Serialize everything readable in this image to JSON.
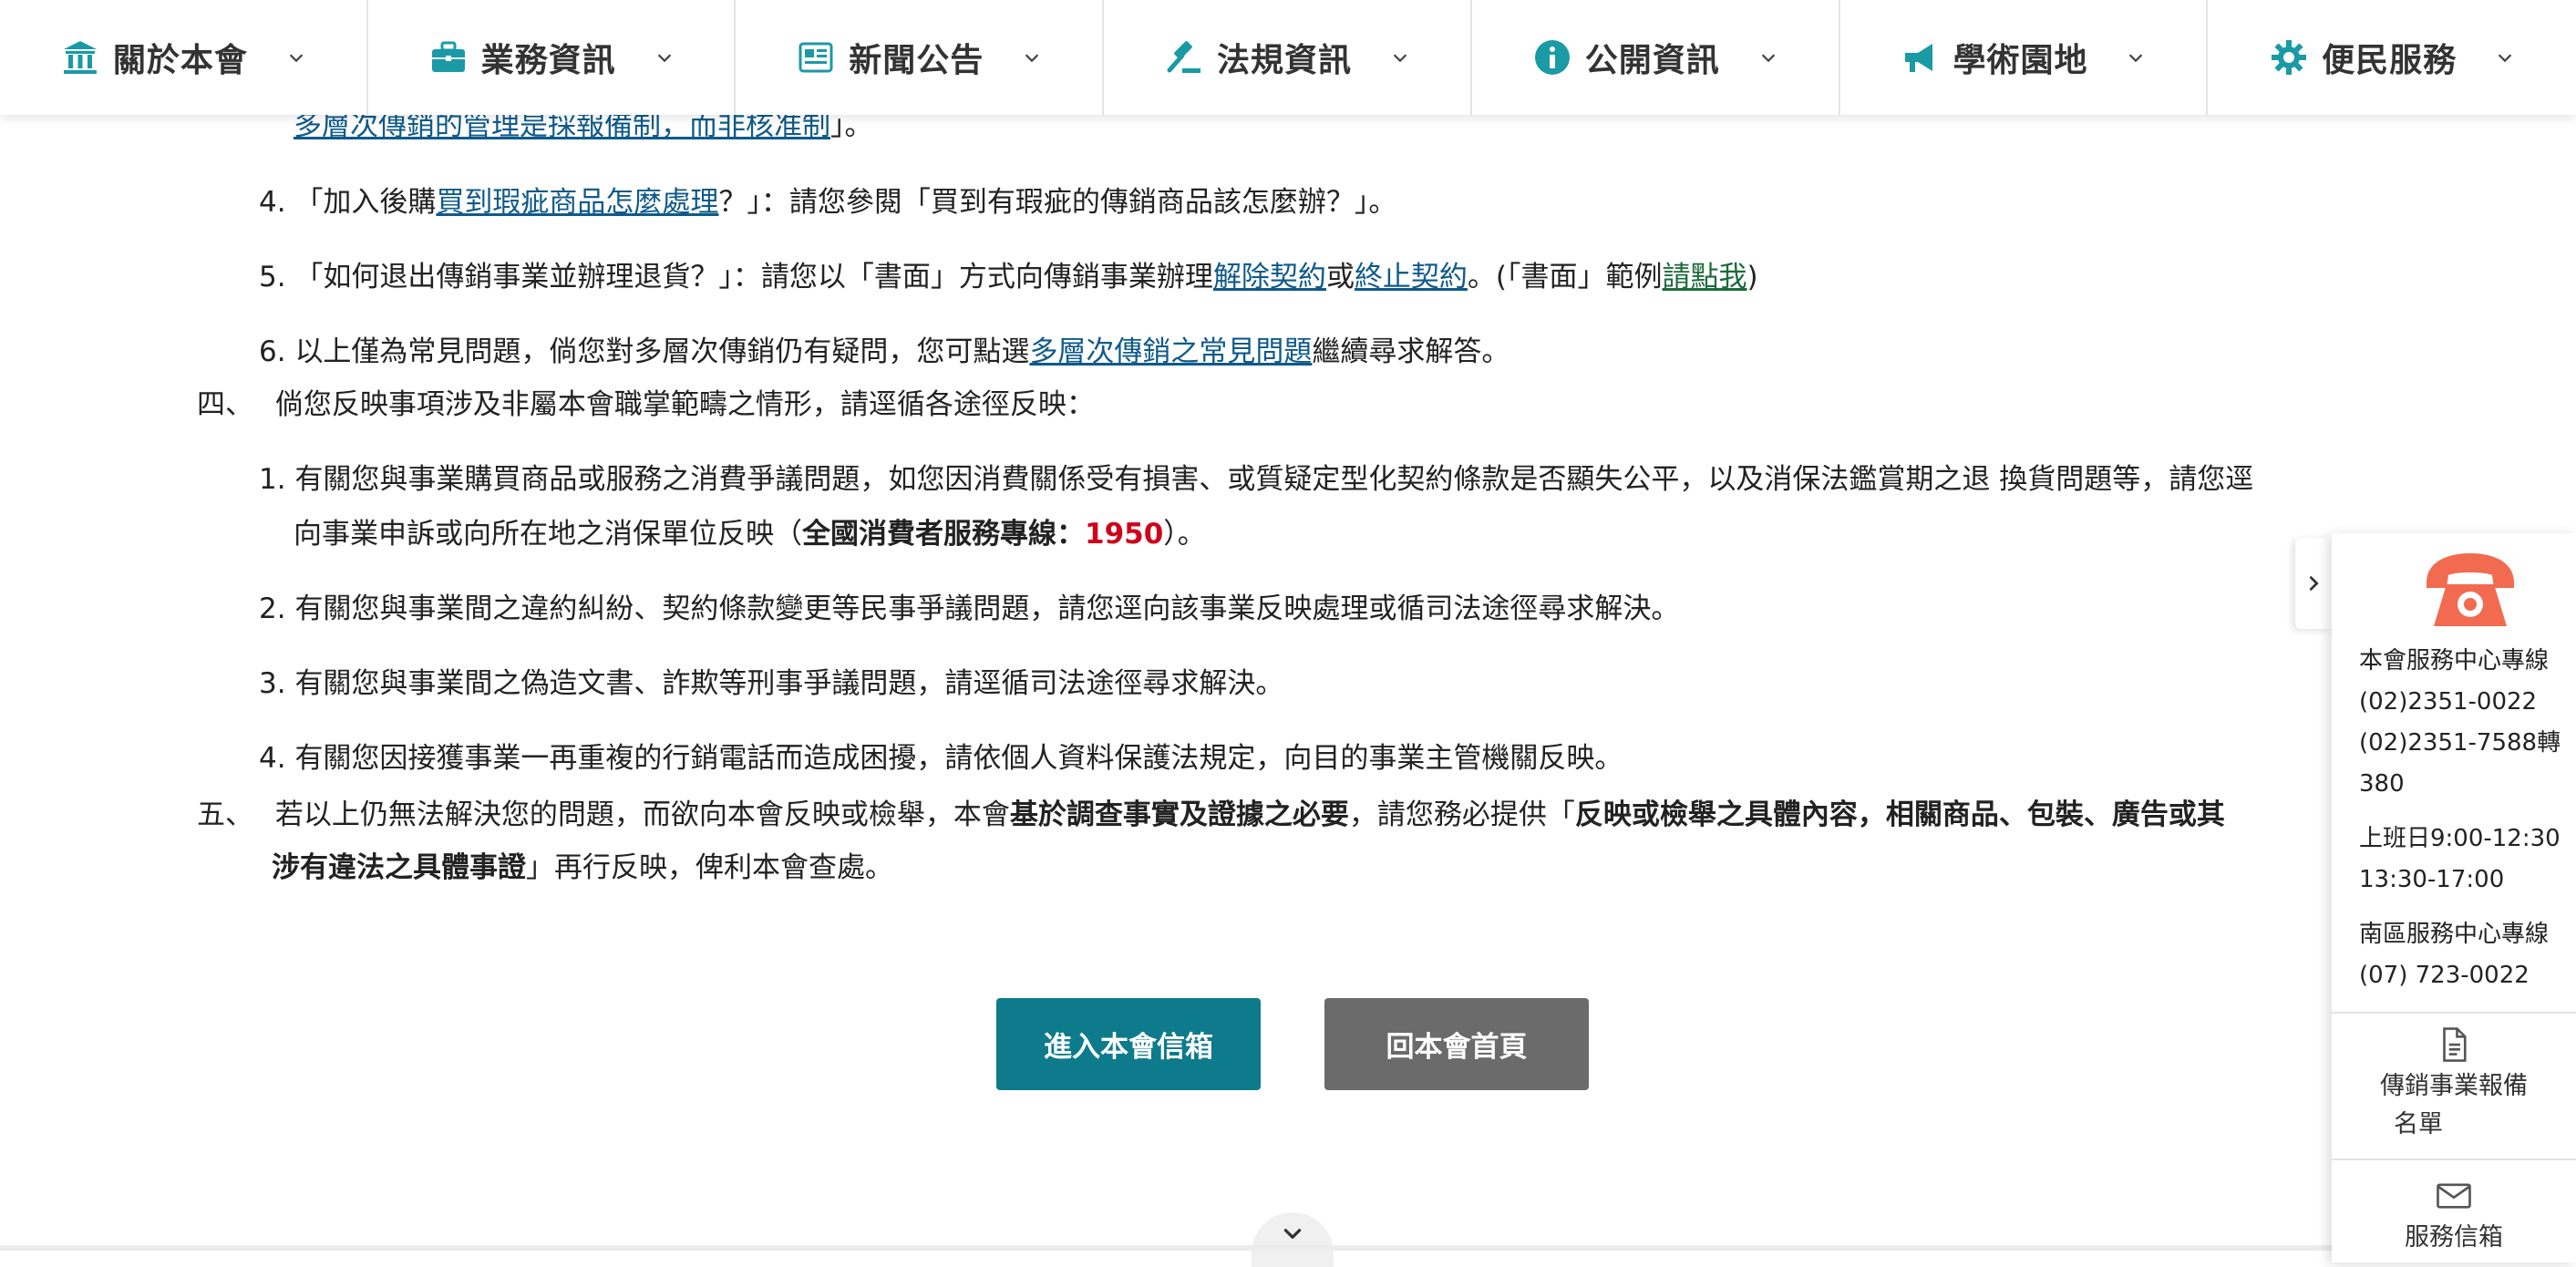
{
  "nav": {
    "items": [
      {
        "label": "關於本會",
        "icon": "bank-icon"
      },
      {
        "label": "業務資訊",
        "icon": "briefcase-icon"
      },
      {
        "label": "新聞公告",
        "icon": "newspaper-icon"
      },
      {
        "label": "法規資訊",
        "icon": "gavel-icon"
      },
      {
        "label": "公開資訊",
        "icon": "info-icon"
      },
      {
        "label": "學術園地",
        "icon": "megaphone-icon"
      },
      {
        "label": "便民服務",
        "icon": "gear-icon"
      }
    ],
    "accent": "#0e7b8c"
  },
  "article": {
    "partial_top_link": "多層次傳銷的管理是採報備制，而非核准制",
    "partial_top_tail": "」。",
    "q4": {
      "num": "4.",
      "pre": "「加入後購",
      "link": "買到瑕疵商品怎麼處理",
      "post": "？」：請您參閱「買到有瑕疵的傳銷商品該怎麼辦？」。"
    },
    "q5": {
      "num": "5.",
      "pre": "「如何退出傳銷事業並辦理退貨？」：請您以「書面」方式向傳銷事業辦理",
      "link1": "解除契約",
      "mid": "或",
      "link2": "終止契約",
      "mid2": "。(「書面」範例",
      "link3": "請點我",
      "post": ")"
    },
    "q6": {
      "num": "6.",
      "pre": "以上僅為常見問題，倘您對多層次傳銷仍有疑問，您可點選",
      "link": "多層次傳銷之常見問題",
      "post": "繼續尋求解答。"
    },
    "sec4": {
      "num": "四、",
      "text": "倘您反映事項涉及非屬本會職掌範疇之情形，請逕循各途徑反映："
    },
    "s4_1": {
      "num": "1.",
      "line1": "有關您與事業購買商品或服務之消費爭議問題，如您因消費關係受有損害、或質疑定型化契約條款是否顯失公平，以及消保法鑑賞期之退 換貨問題等，請您逕",
      "line2_pre": "向事業申訴或向所在地之消保單位反映（",
      "line2_bold": "全國消費者服務專線",
      "line2_colon": "：",
      "line2_red": "1950",
      "line2_post": "）。"
    },
    "s4_2": {
      "num": "2.",
      "text": "有關您與事業間之違約糾紛、契約條款變更等民事爭議問題，請您逕向該事業反映處理或循司法途徑尋求解決。"
    },
    "s4_3": {
      "num": "3.",
      "text": "有關您與事業間之偽造文書、詐欺等刑事爭議問題，請逕循司法途徑尋求解決。"
    },
    "s4_4": {
      "num": "4.",
      "text": "有關您因接獲事業一再重複的行銷電話而造成困擾，請依個人資料保護法規定，向目的事業主管機關反映。"
    },
    "sec5": {
      "num": "五、",
      "pre": "若以上仍無法解決您的問題，而欲向本會反映或檢舉，本會",
      "bold1": "基於調查事實及證據之必要",
      "mid": "，請您務必提供「",
      "bold2": "反映或檢舉之具體內容，相關商品、包裝、廣告或其",
      "line2_bold": "涉有違法之具體事證",
      "line2_post": "」再行反映，俾利本會查處。"
    }
  },
  "buttons": {
    "mailbox": "進入本會信箱",
    "home": "回本會首頁"
  },
  "side_panel": {
    "phone_icon": "phone-icon",
    "service_center_label": "本會服務中心專線",
    "phone1": "(02)2351-0022",
    "phone2": "(02)2351-7588轉",
    "phone2_ext": "380",
    "hours_line1": "上班日9:00-12:30",
    "hours_line2": "13:30-17:00",
    "south_label": "南區服務中心專線",
    "south_phone": "(07) 723-0022",
    "link_registry_line1": "傳銷事業報備",
    "link_registry_line2": "名單",
    "link_mailbox": "服務信箱"
  }
}
